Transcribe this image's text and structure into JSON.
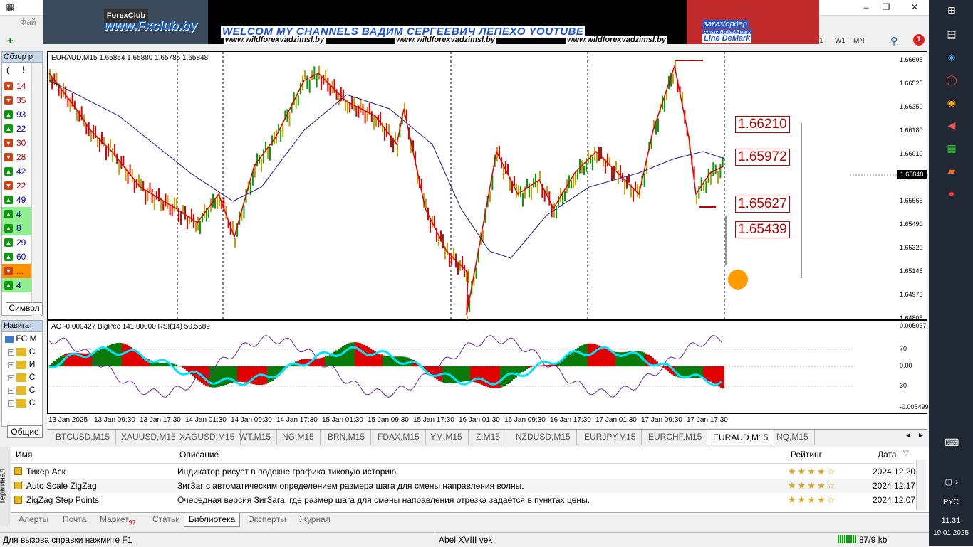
{
  "menu": {
    "file_label": "Фай"
  },
  "banner": {
    "fx_logo": "ForexClub",
    "fxclub": "www.Fxclub.by",
    "welcome": "WELCOM MY CHANNELS ВАДИМ СЕРГЕЕВИЧ ЛЕПЕХО YOUTUBE",
    "url1": "www.wildforexvadzimsl.by",
    "url2": "www.wildforexvadzimsl.by",
    "url3": "www.wildforexvadzimsl.by",
    "zakaz": "заказ/ордер",
    "stik": "стык Bulls&Bears",
    "demark": "Line DeMark"
  },
  "toolbar": {
    "tf1": "1",
    "tf_w1": "W1",
    "tf_mn": "MN",
    "notif_count": "1"
  },
  "market_watch": {
    "header": "Обзор р",
    "col1": "(",
    "col2": "!",
    "rows": [
      {
        "dir": "down",
        "val": "14"
      },
      {
        "dir": "down",
        "val": "35"
      },
      {
        "dir": "up",
        "val": "93"
      },
      {
        "dir": "up",
        "val": "22"
      },
      {
        "dir": "down",
        "val": "30"
      },
      {
        "dir": "down",
        "val": "28"
      },
      {
        "dir": "up",
        "val": "42"
      },
      {
        "dir": "down",
        "val": "22"
      },
      {
        "dir": "up",
        "val": "49"
      },
      {
        "dir": "up",
        "val": "4"
      },
      {
        "dir": "up",
        "val": "8"
      },
      {
        "dir": "up",
        "val": "29"
      },
      {
        "dir": "up",
        "val": "60"
      },
      {
        "dir": "down",
        "val": "..."
      },
      {
        "dir": "up",
        "val": "4"
      }
    ],
    "tab": "Символ"
  },
  "navigator": {
    "header": "Навигат",
    "root": "FC M",
    "items": [
      "C",
      "И",
      "С",
      "С",
      "С"
    ],
    "tab": "Общие"
  },
  "chart": {
    "info": "EURAUD,M15  1.65854 1.65880 1.65785 1.65848",
    "indicator_info": "AO -0.000427  BigPec 141.00000  RSI(14) 50.5589",
    "current_price": "1.65848",
    "price_labels": [
      "1.66695",
      "1.66525",
      "1.66350",
      "1.66180",
      "1.66010",
      "1.65835",
      "1.65665",
      "1.65490",
      "1.65320",
      "1.65145",
      "1.64975",
      "1.64805"
    ],
    "levels": [
      "1.66210",
      "1.65972",
      "1.65627",
      "1.65439"
    ],
    "sub_labels": [
      "0.005037",
      "70",
      "0.00",
      "30",
      "-0.005499"
    ],
    "time_labels": [
      "13 Jan 2025",
      "13 Jan 09:30",
      "13 Jan 17:30",
      "14 Jan 01:30",
      "14 Jan 09:30",
      "14 Jan 17:30",
      "15 Jan 01:30",
      "15 Jan 09:30",
      "15 Jan 17:30",
      "16 Jan 01:30",
      "16 Jan 09:30",
      "16 Jan 17:30",
      "17 Jan 01:30",
      "17 Jan 09:30",
      "17 Jan 17:30"
    ]
  },
  "chart_tabs": [
    "BTCUSD,M15",
    "XAUUSD,M15",
    "XAGUSD,M15",
    "WT,M15",
    "NG,M15",
    "BRN,M15",
    "FDAX,M15",
    "YM,M15",
    "Z,M15",
    "NZDUSD,M15",
    "EURJPY,M15",
    "EURCHF,M15",
    "EURAUD,M15",
    "NQ,M15"
  ],
  "active_chart_tab": "EURAUD,M15",
  "terminal": {
    "side_label": "Терминал",
    "headers": {
      "name": "Имя",
      "desc": "Описание",
      "rating": "Рейтинг",
      "date": "Дата"
    },
    "rows": [
      {
        "name": "Тикер Аск",
        "desc": "Индикатор рисует в подокне графика тиковую историю.",
        "rating": "★★★★☆",
        "date": "2024.12.20"
      },
      {
        "name": "Auto Scale ZigZag",
        "desc": "ЗигЗаг с автоматическим определением размера шага для смены направления волны.",
        "rating": "★★★★☆",
        "date": "2024.12.17"
      },
      {
        "name": "ZigZag Step Points",
        "desc": "Очередная версия ЗигЗага, где размер шага для смены направления отрезка задаётся в пунктах цены.",
        "rating": "★★★★☆",
        "date": "2024.12.07"
      }
    ],
    "tabs": [
      "Алерты",
      "Почта",
      "Маркет",
      "Статьи",
      "Библиотека",
      "Эксперты",
      "Журнал"
    ],
    "market_badge": "97",
    "active_tab": "Библиотека"
  },
  "status": {
    "help": "Для вызова справки нажмите F1",
    "profile": "Abel XVIII vek",
    "traffic": "87/9 kb"
  },
  "taskbar": {
    "lang": "РУС",
    "time": "11:31",
    "date": "19.01.2025"
  },
  "colors": {
    "bull": "#00a000",
    "bear": "#e00000",
    "level": "#c00000",
    "cyan": "#00e5ff",
    "purple": "#6a2a9a",
    "ma": "#1a1a8a"
  }
}
